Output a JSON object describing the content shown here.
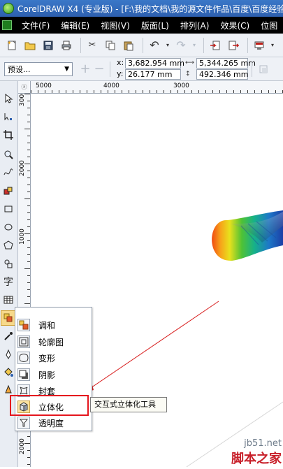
{
  "window": {
    "title": "CorelDRAW X4 (专业版) - [F:\\我的文档\\我的源文件作品\\百度\\百度经验"
  },
  "menu": [
    "文件(F)",
    "编辑(E)",
    "视图(V)",
    "版面(L)",
    "排列(A)",
    "效果(C)",
    "位图"
  ],
  "toolbar": {
    "preset": "预设...",
    "x_label": "x:",
    "y_label": "y:",
    "x_value": "3,682.954 mm",
    "y_value": "26.177 mm",
    "width_value": "5,344.265 mm",
    "height_value": "492.346 mm"
  },
  "ruler": {
    "h_numbers": [
      "5000",
      "4000",
      "3000"
    ],
    "v_numbers": [
      "3000",
      "2000",
      "1000",
      "0",
      "2000"
    ],
    "corner": "ⓐ"
  },
  "flyout": {
    "items": [
      {
        "label": "调和",
        "icon": "blend-icon"
      },
      {
        "label": "轮廓图",
        "icon": "contour-icon"
      },
      {
        "label": "变形",
        "icon": "distort-icon"
      },
      {
        "label": "阴影",
        "icon": "drop-shadow-icon"
      },
      {
        "label": "封套",
        "icon": "envelope-icon"
      },
      {
        "label": "立体化",
        "icon": "extrude-icon"
      },
      {
        "label": "透明度",
        "icon": "transparency-icon"
      }
    ],
    "highlighted": "立体化"
  },
  "tooltip": "交互式立体化工具",
  "watermark": {
    "site": "jb51.net",
    "brand": "脚本之家"
  },
  "colors": {
    "titlebar": "#2d5fae",
    "menubar": "#000000",
    "highlight_box": "#e5151d",
    "annotation_arrow": "#d81e1e"
  }
}
